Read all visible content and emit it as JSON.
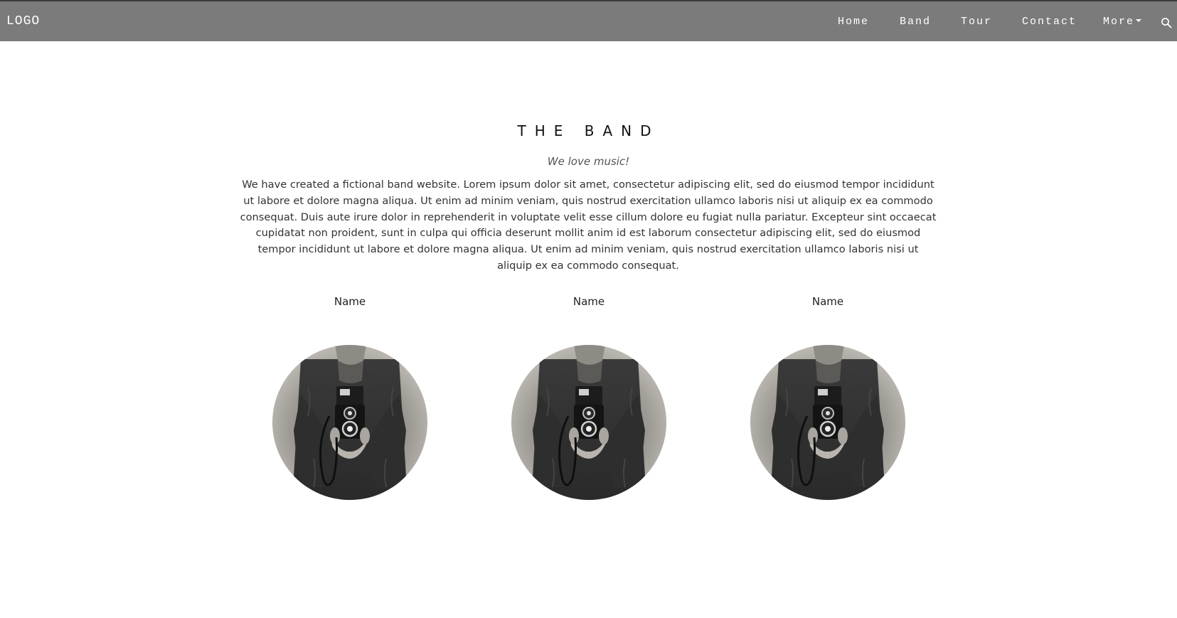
{
  "nav": {
    "logo": "LOGO",
    "items": [
      {
        "label": "Home"
      },
      {
        "label": "Band"
      },
      {
        "label": "Tour"
      },
      {
        "label": "Contact"
      },
      {
        "label": "More"
      }
    ],
    "search_icon": "search-icon",
    "bar_color": "#7b7b7b"
  },
  "band": {
    "title": "THE BAND",
    "tagline": "We love music!",
    "description": "We have created a fictional band website. Lorem ipsum dolor sit amet, consectetur adipiscing elit, sed do eiusmod tempor incididunt ut labore et dolore magna aliqua. Ut enim ad minim veniam, quis nostrud exercitation ullamco laboris nisi ut aliquip ex ea commodo consequat. Duis aute irure dolor in reprehenderit in voluptate velit esse cillum dolore eu fugiat nulla pariatur. Excepteur sint occaecat cupidatat non proident, sunt in culpa qui officia deserunt mollit anim id est laborum consectetur adipiscing elit, sed do eiusmod tempor incididunt ut labore et dolore magna aliqua. Ut enim ad minim veniam, quis nostrud exercitation ullamco laboris nisi ut aliquip ex ea commodo consequat.",
    "members": [
      {
        "name": "Name"
      },
      {
        "name": "Name"
      },
      {
        "name": "Name"
      }
    ]
  }
}
